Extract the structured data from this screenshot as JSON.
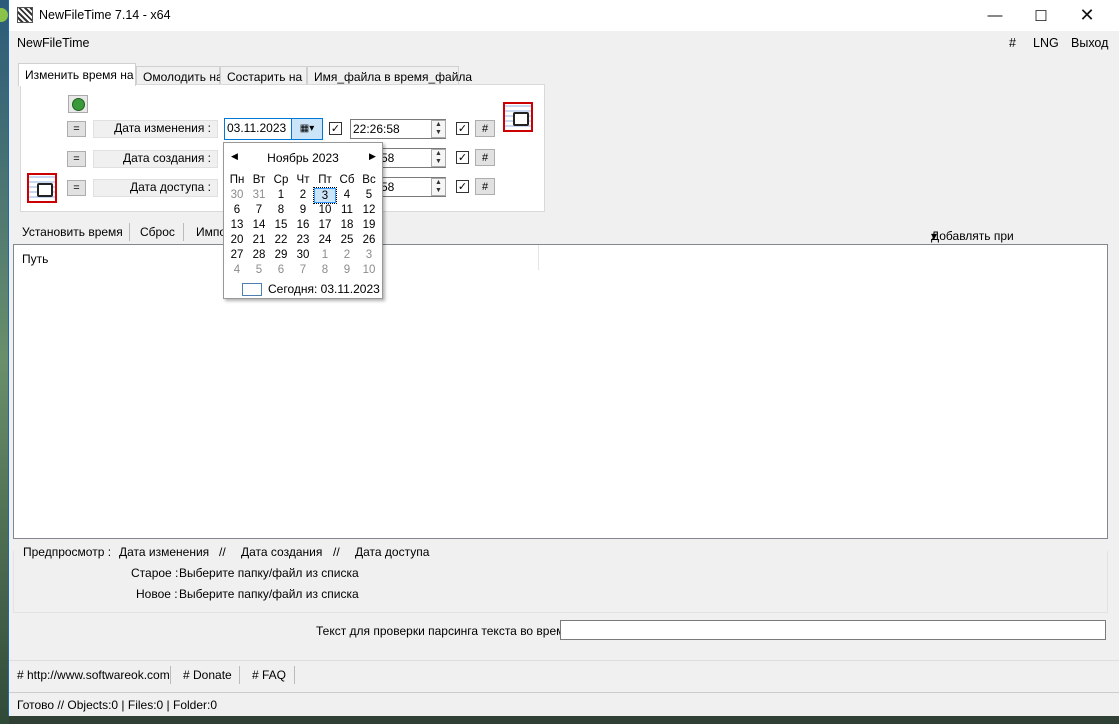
{
  "window": {
    "title": "NewFileTime 7.14 - x64"
  },
  "menu": {
    "app": "NewFileTime",
    "hash": "#",
    "lng": "LNG",
    "exit": "Выход"
  },
  "tabs": [
    "Изменить время на",
    "Омолодить на",
    "Состарить на",
    "Имя_файла в время_файла"
  ],
  "rows": [
    {
      "eq": "=",
      "label": "Дата изменения :",
      "date": "03.11.2023",
      "time": "22:26:58",
      "hash": "#"
    },
    {
      "eq": "=",
      "label": "Дата создания :",
      "date": "",
      "time": "58",
      "hash": "#"
    },
    {
      "eq": "=",
      "label": "Дата доступа :",
      "date": "",
      "time": "58",
      "hash": "#"
    }
  ],
  "toolbar": {
    "set_time": "Установить время",
    "reset": "Сброс",
    "import": "Импо",
    "drag_add": "Добавлять при перетягивании:"
  },
  "list": {
    "column_path": "Путь"
  },
  "preview": {
    "label": "Предпросмотр :",
    "col1": "Дата изменения",
    "sep1": "//",
    "col2": "Дата создания",
    "sep2": "//",
    "col3": "Дата доступа",
    "old_label": "Старое :",
    "old_value": "Выберите папку/файл из списка",
    "new_label": "Новое :",
    "new_value": "Выберите папку/файл из списка"
  },
  "parse": {
    "label": "Текст для проверки парсинга текста во время",
    "value": ""
  },
  "links": {
    "site": "# http://www.softwareok.com",
    "donate": "# Donate",
    "faq": "# FAQ"
  },
  "status": {
    "text": "Готово // Objects:0 | Files:0  | Folder:0"
  },
  "calendar": {
    "month": "Ноябрь 2023",
    "weekdays": [
      "Пн",
      "Вт",
      "Ср",
      "Чт",
      "Пт",
      "Сб",
      "Вс"
    ],
    "days": [
      [
        "30",
        "31",
        "1",
        "2",
        "3",
        "4",
        "5"
      ],
      [
        "6",
        "7",
        "8",
        "9",
        "10",
        "11",
        "12"
      ],
      [
        "13",
        "14",
        "15",
        "16",
        "17",
        "18",
        "19"
      ],
      [
        "20",
        "21",
        "22",
        "23",
        "24",
        "25",
        "26"
      ],
      [
        "27",
        "28",
        "29",
        "30",
        "1",
        "2",
        "3"
      ],
      [
        "4",
        "5",
        "6",
        "7",
        "8",
        "9",
        "10"
      ]
    ],
    "selected": "3",
    "today": "Сегодня: 03.11.2023"
  }
}
